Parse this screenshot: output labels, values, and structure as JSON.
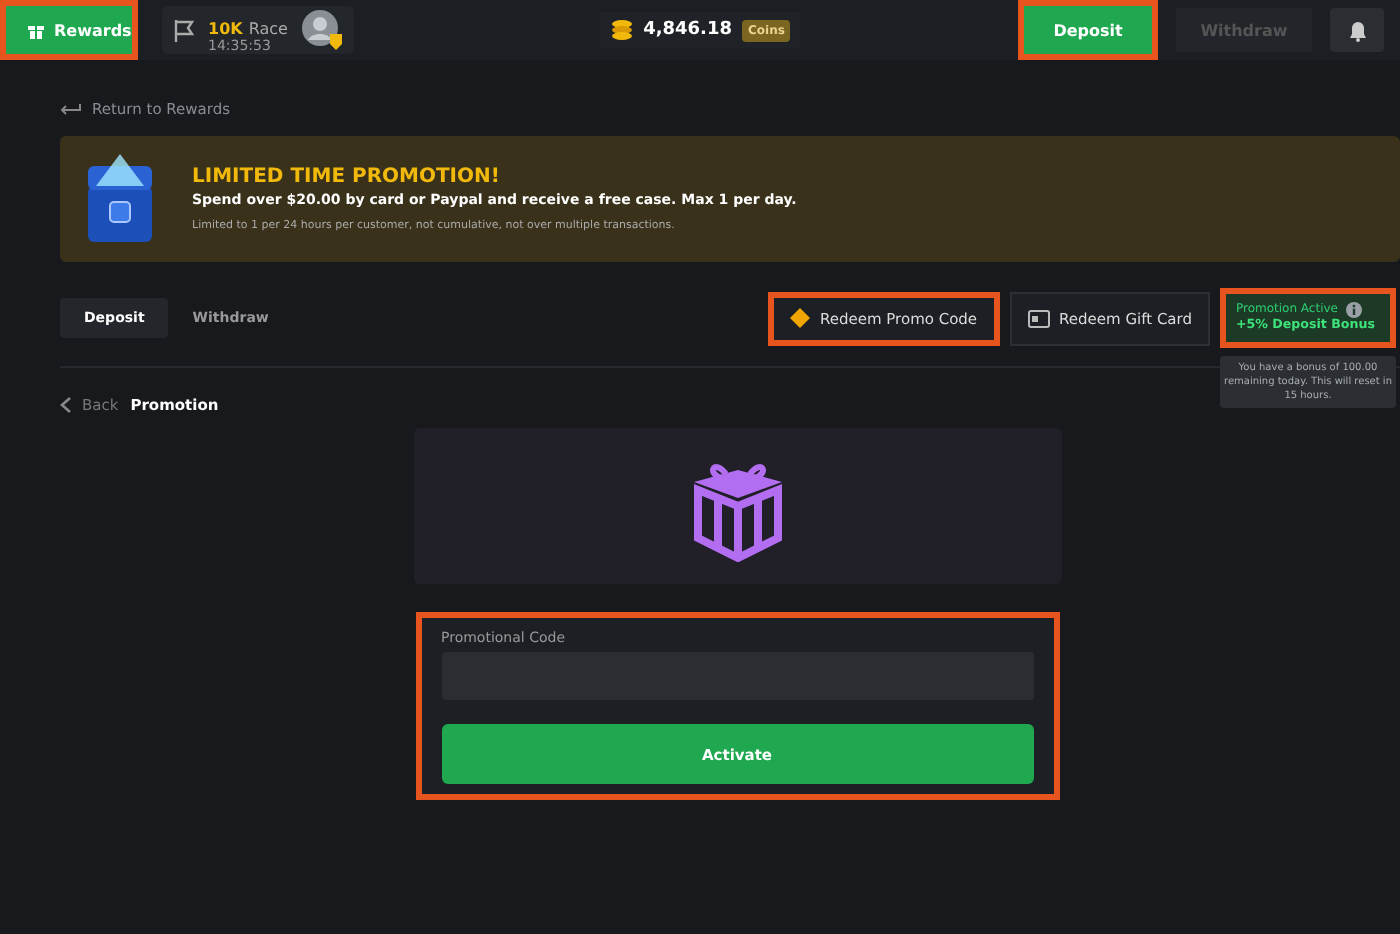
{
  "top_bar": {
    "rewards_button": {
      "label": "Rewards",
      "highlighted": true
    },
    "race": {
      "title": "10K",
      "subtitle": "Race",
      "time": "14:35:53"
    },
    "balance": {
      "amount": "4,846.18",
      "currency": "Coins"
    },
    "deposit_button": {
      "label": "Deposit",
      "highlighted": true,
      "disabled": false
    },
    "withdraw_button": {
      "label": "Withdraw",
      "highlighted": false,
      "disabled": true
    }
  },
  "return_link": "Return to Rewards",
  "promo_banner": {
    "title": "LIMITED TIME PROMOTION!",
    "text": "Spend over **$20.00** by card or Paypal and receive a free case. Max 1 per day.",
    "note": "Limited to 1 per 24 hours per customer, not cumulative, not over multiple transactions."
  },
  "tabs": [
    {
      "label": "Deposit",
      "selected": true
    },
    {
      "label": "Withdraw",
      "selected": false
    }
  ],
  "actions": [
    {
      "label": "Redeem Promo Code",
      "kind": "promo",
      "highlighted": true
    },
    {
      "label": "Redeem Gift Card",
      "kind": "giftcard",
      "highlighted": false
    }
  ],
  "promotion_badge": {
    "status": "Promotion Active",
    "bonus": "+5% Deposit Bonus",
    "highlighted": true,
    "tooltip": "You have a bonus of 100.00 remaining today. This will reset in 15 hours."
  },
  "breadcrumb": {
    "back": "Back",
    "current": "Promotion"
  },
  "form": {
    "label": "Promotional Code",
    "button": "Activate",
    "highlighted": true
  }
}
